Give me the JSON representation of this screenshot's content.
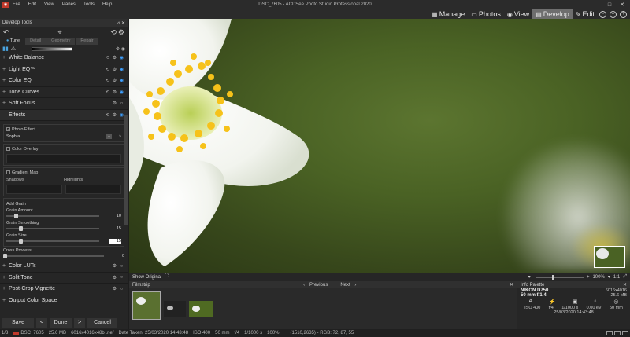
{
  "app": {
    "window_title": "DSC_7605 - ACDSee Photo Studio Professional 2020",
    "menu": [
      "File",
      "Edit",
      "View",
      "Panes",
      "Tools",
      "Help"
    ],
    "win_controls": [
      "—",
      "□",
      "✕"
    ]
  },
  "modes": [
    {
      "label": "Manage",
      "icon": "▦",
      "active": false
    },
    {
      "label": "Photos",
      "icon": "▭",
      "active": false
    },
    {
      "label": "View",
      "icon": "◉",
      "active": false
    },
    {
      "label": "Develop",
      "icon": "▤",
      "active": true
    },
    {
      "label": "Edit",
      "icon": "✎",
      "active": false
    }
  ],
  "left_panel": {
    "title": "Develop Tools",
    "pin": "📌",
    "close": "✕",
    "tabs": [
      {
        "label": "Tune",
        "active": true
      },
      {
        "label": "Detail",
        "active": false
      },
      {
        "label": "Geometry",
        "active": false
      },
      {
        "label": "Repair",
        "active": false
      }
    ],
    "sections_top": [
      "White Balance",
      "Light EQ™",
      "Color EQ",
      "Tone Curves",
      "Soft Focus",
      "Effects"
    ],
    "effects": {
      "photo_effect_label": "Photo Effect",
      "photo_effect_value": "Sophia",
      "color_overlay_label": "Color Overlay",
      "gradient_map_label": "Gradient Map",
      "shadows_label": "Shadows",
      "highlights_label": "Highlights",
      "add_grain_label": "Add Grain",
      "grain_amount_label": "Grain Amount",
      "grain_amount_value": "10",
      "grain_smoothing_label": "Grain Smoothing",
      "grain_smoothing_value": "15",
      "grain_size_label": "Grain Size",
      "grain_size_value": "15",
      "cross_process_label": "Cross Process",
      "cross_process_value": "0"
    },
    "sections_bottom": [
      "Color LUTs",
      "Split Tone",
      "Post-Crop Vignette",
      "Output Color Space"
    ],
    "buttons": {
      "save": "Save",
      "prev": "<",
      "done": "Done",
      "next": ">",
      "cancel": "Cancel"
    }
  },
  "viewer": {
    "show_original": "Show Original",
    "zoom": "100%",
    "ratio": "1:1"
  },
  "filmstrip": {
    "title": "Filmstrip",
    "previous": "Previous",
    "next": "Next"
  },
  "info_palette": {
    "title": "Info Palette",
    "camera": "NIKON D750",
    "dimensions": "6016x4016",
    "lens": "50 mm f/1.4",
    "size": "25.6 MB",
    "icons": [
      "A",
      "⚡",
      "▣",
      "◐",
      "◎"
    ],
    "values": [
      "ISO 400",
      "f/4",
      "1/1000 s",
      "0.00 eV",
      "50 mm"
    ],
    "date": "25/03/2020 14:43:48"
  },
  "status": {
    "count": "1/3",
    "filename": "DSC_7605",
    "filesize": "25.6 MB",
    "dims": "6016x4016x48b .nef",
    "date_taken": "Date Taken: 25/03/2020 14:43:48",
    "iso": "ISO 400",
    "focal": "50 mm",
    "aperture": "f/4",
    "shutter": "1/1000 s",
    "zoom": "100%",
    "coords": "(1510,2635) - RGB: 72, 87, 55"
  }
}
